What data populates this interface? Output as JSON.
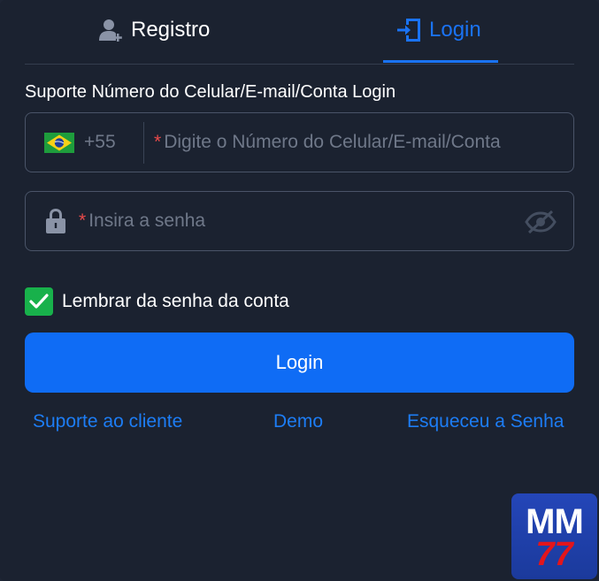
{
  "tabs": {
    "register_label": "Registro",
    "login_label": "Login",
    "active": "login"
  },
  "form": {
    "support_label": "Suporte Número do Celular/E-mail/Conta Login",
    "country_code": "+55",
    "account_placeholder": "Digite o Número do Celular/E-mail/Conta",
    "password_placeholder": "Insira a senha",
    "required_mark": "*",
    "remember_label": "Lembrar da senha da conta",
    "remember_checked": true,
    "login_button": "Login"
  },
  "links": {
    "support": "Suporte ao cliente",
    "demo": "Demo",
    "forgot": "Esqueceu a Senha"
  },
  "logo": {
    "line1": "MM",
    "line2": "77"
  },
  "colors": {
    "background": "#1b2230",
    "accent": "#1a73f5",
    "button": "#0f6cf5",
    "checkbox": "#18b14b",
    "required": "#e84a4a"
  },
  "icons": {
    "register": "user-plus-icon",
    "login": "door-enter-icon",
    "flag": "brazil-flag-icon",
    "lock": "lock-icon",
    "eye": "eye-off-icon",
    "check": "check-icon"
  }
}
